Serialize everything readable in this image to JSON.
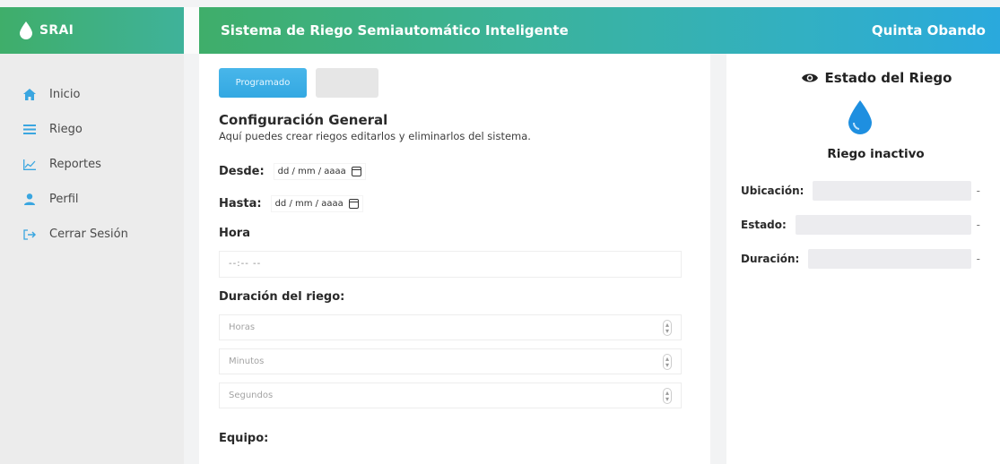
{
  "brand": {
    "name": "SRAI"
  },
  "header": {
    "title": "Sistema de Riego Semiautomático Inteligente",
    "user": "Quinta Obando"
  },
  "sidebar": {
    "items": [
      {
        "label": "Inicio",
        "icon": "home-icon"
      },
      {
        "label": "Riego",
        "icon": "list-icon"
      },
      {
        "label": "Reportes",
        "icon": "chart-icon"
      },
      {
        "label": "Perfil",
        "icon": "user-icon"
      },
      {
        "label": "Cerrar Sesión",
        "icon": "logout-icon"
      }
    ]
  },
  "main": {
    "tabs": [
      {
        "label": "Programado",
        "active": true
      },
      {
        "label": "",
        "active": false
      }
    ],
    "section_title": "Configuración General",
    "section_subtitle": "Aquí puedes crear riegos editarlos y eliminarlos del sistema.",
    "desde_label": "Desde:",
    "desde_value": "dd / mm / aaaa",
    "hasta_label": "Hasta:",
    "hasta_value": "dd / mm / aaaa",
    "hora_label": "Hora",
    "hora_value": "--:-- --",
    "duracion_label": "Duración del riego:",
    "horas_placeholder": "Horas",
    "minutos_placeholder": "Minutos",
    "segundos_placeholder": "Segundos",
    "equipo_label": "Equipo:"
  },
  "status": {
    "title": "Estado del Riego",
    "state_text": "Riego inactivo",
    "rows": [
      {
        "label": "Ubicación:",
        "value": "-"
      },
      {
        "label": "Estado:",
        "value": "-"
      },
      {
        "label": "Duración:",
        "value": "-"
      }
    ]
  },
  "colors": {
    "accent_green": "#3fae6a",
    "accent_blue": "#2aa9dd",
    "tab_active": "#3aade5",
    "drop": "#1e8fe0"
  }
}
